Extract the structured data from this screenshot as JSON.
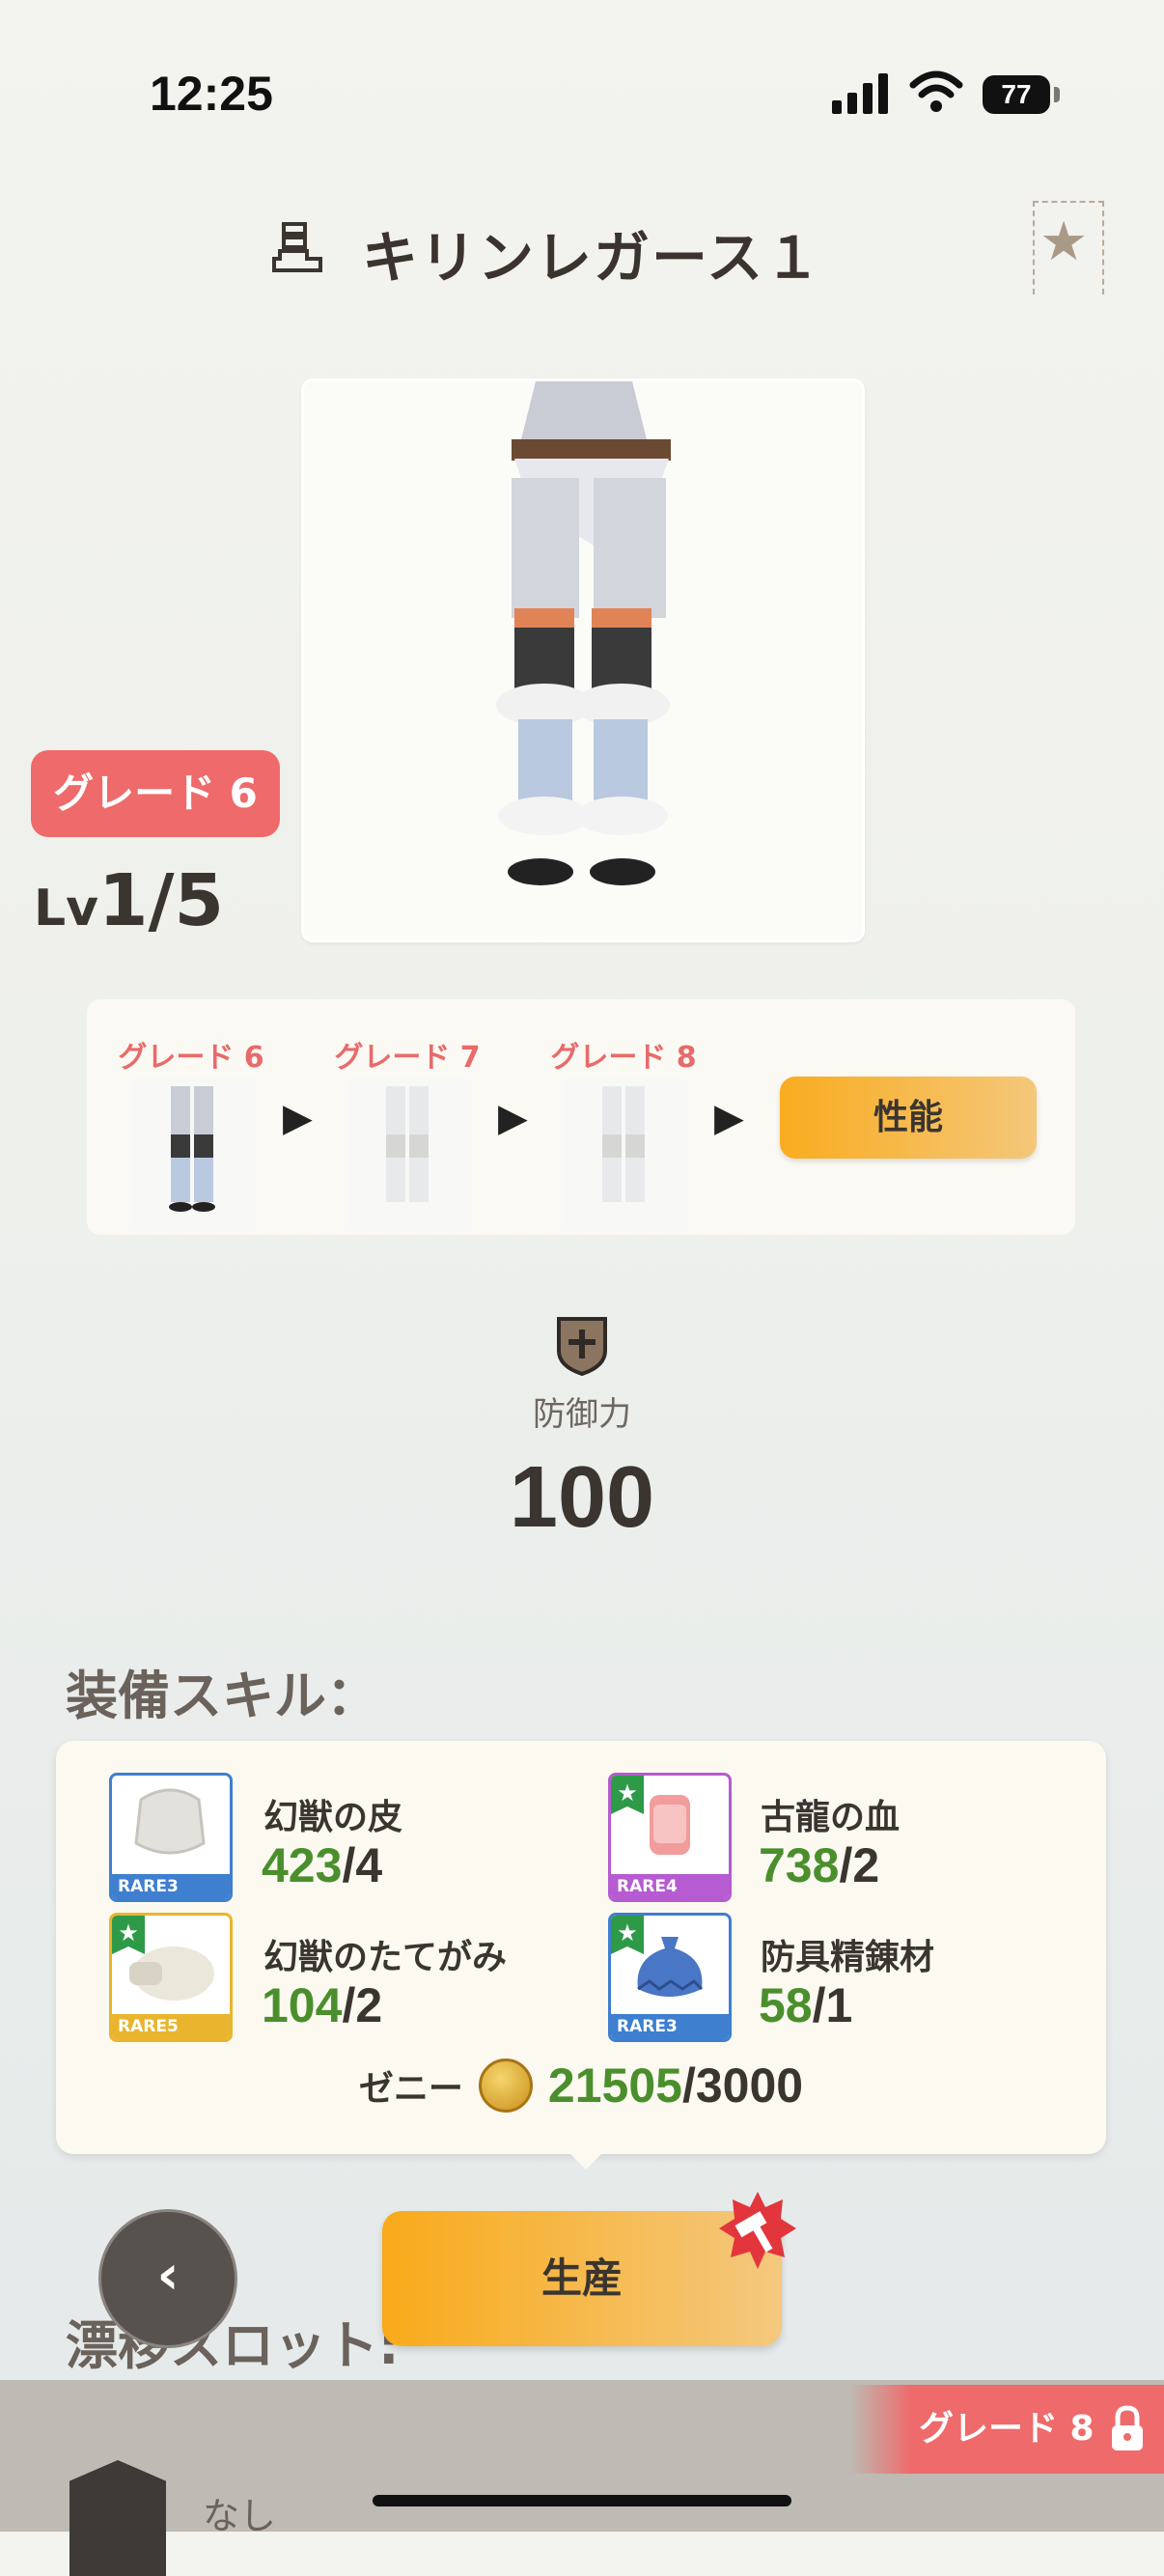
{
  "status_bar": {
    "time": "12:25",
    "battery": "77"
  },
  "header": {
    "title": "キリンレガース１"
  },
  "equipment": {
    "grade": "グレード 6",
    "level_prefix": "Lv",
    "level": "1/5"
  },
  "upgrade_path": {
    "steps": [
      {
        "label": "グレード 6"
      },
      {
        "label": "グレード 7"
      },
      {
        "label": "グレード 8"
      }
    ],
    "performance_button": "性能"
  },
  "defense": {
    "label": "防御力",
    "value": "100"
  },
  "skills": {
    "title": "装備スキル：",
    "materials": [
      {
        "name": "幻獣の皮",
        "have": "423",
        "need": "/4",
        "rarity": "RARE3",
        "starred": false,
        "color": "#3e7fd0"
      },
      {
        "name": "古龍の血",
        "have": "738",
        "need": "/2",
        "rarity": "RARE4",
        "starred": true,
        "color": "#b65bd1"
      },
      {
        "name": "幻獣のたてがみ",
        "have": "104",
        "need": "/2",
        "rarity": "RARE5",
        "starred": true,
        "color": "#e9b52e"
      },
      {
        "name": "防具精錬材",
        "have": "58",
        "need": "/1",
        "rarity": "RARE3",
        "starred": true,
        "color": "#3e7fd0"
      }
    ],
    "zeny": {
      "label": "ゼニー",
      "have": "21505",
      "need": "/3000"
    }
  },
  "actions": {
    "back": "‹",
    "produce": "生産"
  },
  "slots": {
    "title": "漂移スロット:",
    "value": "なし"
  },
  "locked_tab": {
    "label": "グレード 8"
  }
}
